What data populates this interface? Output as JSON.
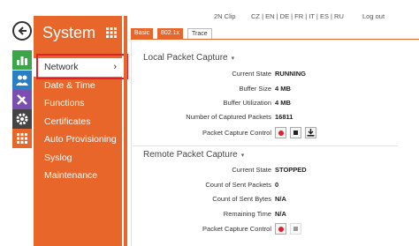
{
  "sidebar": {
    "title": "System",
    "items": [
      {
        "label": "Network",
        "active": true,
        "chevron": "›"
      },
      {
        "label": "Date & Time"
      },
      {
        "label": "Functions"
      },
      {
        "label": "Certificates"
      },
      {
        "label": "Auto Provisioning"
      },
      {
        "label": "Syslog"
      },
      {
        "label": "Maintenance"
      }
    ]
  },
  "topbar": {
    "device": "2N Clip",
    "languages": "CZ | EN | DE | FR | IT | ES | RU",
    "logout": "Log out"
  },
  "tabs": [
    {
      "label": "Basic"
    },
    {
      "label": "802.1x"
    },
    {
      "label": "Trace",
      "active": true
    }
  ],
  "local_capture": {
    "title": "Local Packet Capture",
    "caret": "▾",
    "rows": [
      {
        "label": "Current State",
        "value": "RUNNING"
      },
      {
        "label": "Buffer Size",
        "value": "4 MB"
      },
      {
        "label": "Buffer Utilization",
        "value": "4 MB"
      },
      {
        "label": "Number of Captured Packets",
        "value": "16811"
      },
      {
        "label": "Packet Capture Control",
        "value": ""
      }
    ]
  },
  "remote_capture": {
    "title": "Remote Packet Capture",
    "caret": "▾",
    "rows": [
      {
        "label": "Current State",
        "value": "STOPPED"
      },
      {
        "label": "Count of Sent Packets",
        "value": "0"
      },
      {
        "label": "Count of Sent Bytes",
        "value": "N/A"
      },
      {
        "label": "Remaining Time",
        "value": "N/A"
      },
      {
        "label": "Packet Capture Control",
        "value": ""
      }
    ]
  },
  "colors": {
    "accent": "#e8662a",
    "highlight": "#e0202a",
    "icon_green": "#3aa648",
    "icon_blue": "#2a7fc4",
    "icon_purple": "#7a4fb0",
    "icon_gray": "#444444",
    "icon_orange": "#e8662a"
  },
  "icons": [
    "back-icon",
    "chart-icon",
    "users-icon",
    "tools-icon",
    "gear-icon",
    "grid-icon"
  ]
}
